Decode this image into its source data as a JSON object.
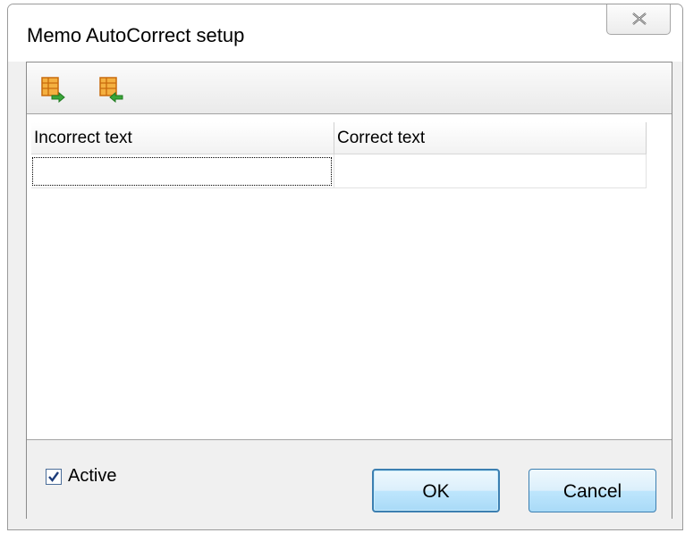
{
  "window": {
    "title": "Memo AutoCorrect setup"
  },
  "icons": {
    "close": "close-icon",
    "add_row": "add-row-icon",
    "remove_row": "remove-row-icon",
    "check": "check-icon"
  },
  "grid": {
    "columns": [
      "Incorrect text",
      "Correct text"
    ],
    "rows": [
      {
        "incorrect": "",
        "correct": ""
      }
    ]
  },
  "footer": {
    "active_label": "Active",
    "active_checked": true,
    "ok_label": "OK",
    "cancel_label": "Cancel"
  },
  "colors": {
    "accent": "#3c7fb1",
    "toolbar_icon_orange": "#e88a1a",
    "toolbar_icon_green": "#2f9a2f"
  }
}
